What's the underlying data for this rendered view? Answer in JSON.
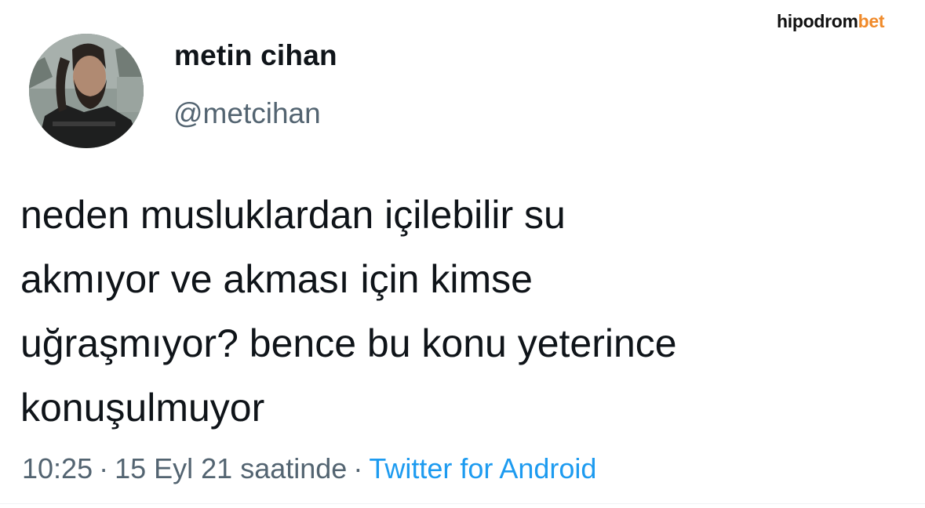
{
  "watermark": {
    "part1": "hipodrom",
    "part2": "bet",
    "accent_color": "#f08a2a"
  },
  "tweet": {
    "author": {
      "display_name": "metin cihan",
      "handle": "@metcihan",
      "avatar": "profile-photo"
    },
    "text": "neden musluklardan içilebilir su\nakmıyor ve akması için kimse\nuğraşmıyor? bence bu konu yeterince\nkonuşulmuyor",
    "time": "10:25",
    "separator": "·",
    "date": "15 Eyl 21 saatinde",
    "source": "Twitter for Android",
    "colors": {
      "text": "#0f1419",
      "secondary": "#536471",
      "link": "#1d9bf0"
    }
  }
}
